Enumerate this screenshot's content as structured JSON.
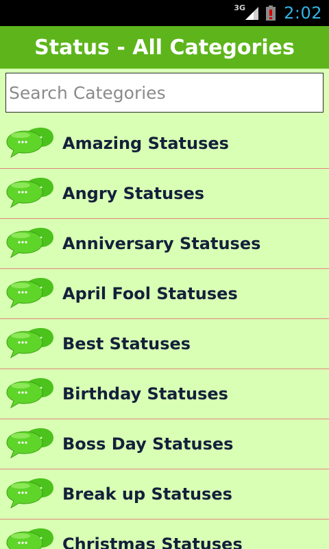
{
  "status_bar": {
    "network": "3G",
    "time": "2:02",
    "icons": [
      "signal-icon",
      "battery-alert-icon"
    ]
  },
  "header": {
    "title": "Status - All Categories"
  },
  "search": {
    "placeholder": "Search Categories",
    "value": ""
  },
  "categories": [
    {
      "label": "Amazing Statuses",
      "icon": "chat-bubbles-icon"
    },
    {
      "label": "Angry Statuses",
      "icon": "chat-bubbles-icon"
    },
    {
      "label": "Anniversary Statuses",
      "icon": "chat-bubbles-icon"
    },
    {
      "label": "April Fool Statuses",
      "icon": "chat-bubbles-icon"
    },
    {
      "label": "Best Statuses",
      "icon": "chat-bubbles-icon"
    },
    {
      "label": "Birthday Statuses",
      "icon": "chat-bubbles-icon"
    },
    {
      "label": "Boss Day Statuses",
      "icon": "chat-bubbles-icon"
    },
    {
      "label": "Break up Statuses",
      "icon": "chat-bubbles-icon"
    },
    {
      "label": "Christmas Statuses",
      "icon": "chat-bubbles-icon"
    }
  ],
  "colors": {
    "title_bar": "#5db51b",
    "background": "#d8ffb4",
    "divider": "#e3847e",
    "label_text": "#14203a",
    "clock": "#33b5e5",
    "icon_green": "#4cc21c"
  }
}
